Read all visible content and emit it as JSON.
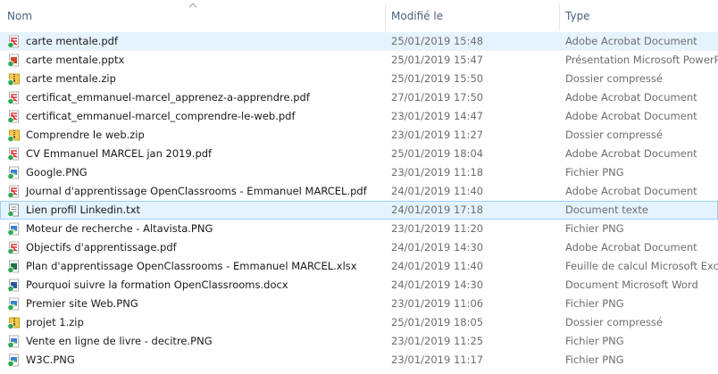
{
  "columns": {
    "name": "Nom",
    "modified": "Modifié le",
    "type": "Type"
  },
  "files": [
    {
      "name": "carte mentale.pdf",
      "modified": "25/01/2019 15:48",
      "type": "Adobe Acrobat Document",
      "icon": "pdf-file-icon",
      "state": "selected"
    },
    {
      "name": "carte mentale.pptx",
      "modified": "25/01/2019 15:47",
      "type": "Présentation Microsoft PowerPoint",
      "icon": "pptx-file-icon",
      "state": ""
    },
    {
      "name": "carte mentale.zip",
      "modified": "25/01/2019 15:50",
      "type": "Dossier compressé",
      "icon": "zip-file-icon",
      "state": ""
    },
    {
      "name": "certificat_emmanuel-marcel_apprenez-a-apprendre.pdf",
      "modified": "27/01/2019 17:50",
      "type": "Adobe Acrobat Document",
      "icon": "pdf-file-icon",
      "state": ""
    },
    {
      "name": "certificat_emmanuel-marcel_comprendre-le-web.pdf",
      "modified": "23/01/2019 14:47",
      "type": "Adobe Acrobat Document",
      "icon": "pdf-file-icon",
      "state": ""
    },
    {
      "name": "Comprendre le web.zip",
      "modified": "23/01/2019 11:27",
      "type": "Dossier compressé",
      "icon": "zip-file-icon",
      "state": ""
    },
    {
      "name": "CV Emmanuel MARCEL jan 2019.pdf",
      "modified": "25/01/2019 18:04",
      "type": "Adobe Acrobat Document",
      "icon": "pdf-file-icon",
      "state": ""
    },
    {
      "name": "Google.PNG",
      "modified": "23/01/2019 11:18",
      "type": "Fichier PNG",
      "icon": "png-file-icon",
      "state": ""
    },
    {
      "name": "Journal d'apprentissage OpenClassrooms - Emmanuel MARCEL.pdf",
      "modified": "24/01/2019 11:40",
      "type": "Adobe Acrobat Document",
      "icon": "pdf-file-icon",
      "state": ""
    },
    {
      "name": "Lien profil Linkedin.txt",
      "modified": "24/01/2019 17:18",
      "type": "Document texte",
      "icon": "txt-file-icon",
      "state": "focused"
    },
    {
      "name": "Moteur de recherche - Altavista.PNG",
      "modified": "23/01/2019 11:20",
      "type": "Fichier PNG",
      "icon": "png-file-icon",
      "state": ""
    },
    {
      "name": "Objectifs d'apprentissage.pdf",
      "modified": "24/01/2019 14:30",
      "type": "Adobe Acrobat Document",
      "icon": "pdf-file-icon",
      "state": ""
    },
    {
      "name": "Plan d'apprentissage OpenClassrooms - Emmanuel MARCEL.xlsx",
      "modified": "24/01/2019 11:40",
      "type": "Feuille de calcul Microsoft Excel",
      "icon": "xlsx-file-icon",
      "state": ""
    },
    {
      "name": "Pourquoi suivre la formation OpenClassrooms.docx",
      "modified": "24/01/2019 14:30",
      "type": "Document Microsoft Word",
      "icon": "docx-file-icon",
      "state": ""
    },
    {
      "name": "Premier site Web.PNG",
      "modified": "23/01/2019 11:06",
      "type": "Fichier PNG",
      "icon": "png-file-icon",
      "state": ""
    },
    {
      "name": "projet 1.zip",
      "modified": "25/01/2019 18:05",
      "type": "Dossier compressé",
      "icon": "zip-file-icon",
      "state": ""
    },
    {
      "name": "Vente en ligne de livre - decitre.PNG",
      "modified": "23/01/2019 11:25",
      "type": "Fichier PNG",
      "icon": "png-file-icon",
      "state": ""
    },
    {
      "name": "W3C.PNG",
      "modified": "23/01/2019 11:17",
      "type": "Fichier PNG",
      "icon": "png-file-icon",
      "state": ""
    }
  ],
  "colors": {
    "header_text": "#4c607a",
    "selected_bg": "#e5f3ff",
    "focus_border": "#99d1ff",
    "secondary_text": "#6d6d6d"
  }
}
